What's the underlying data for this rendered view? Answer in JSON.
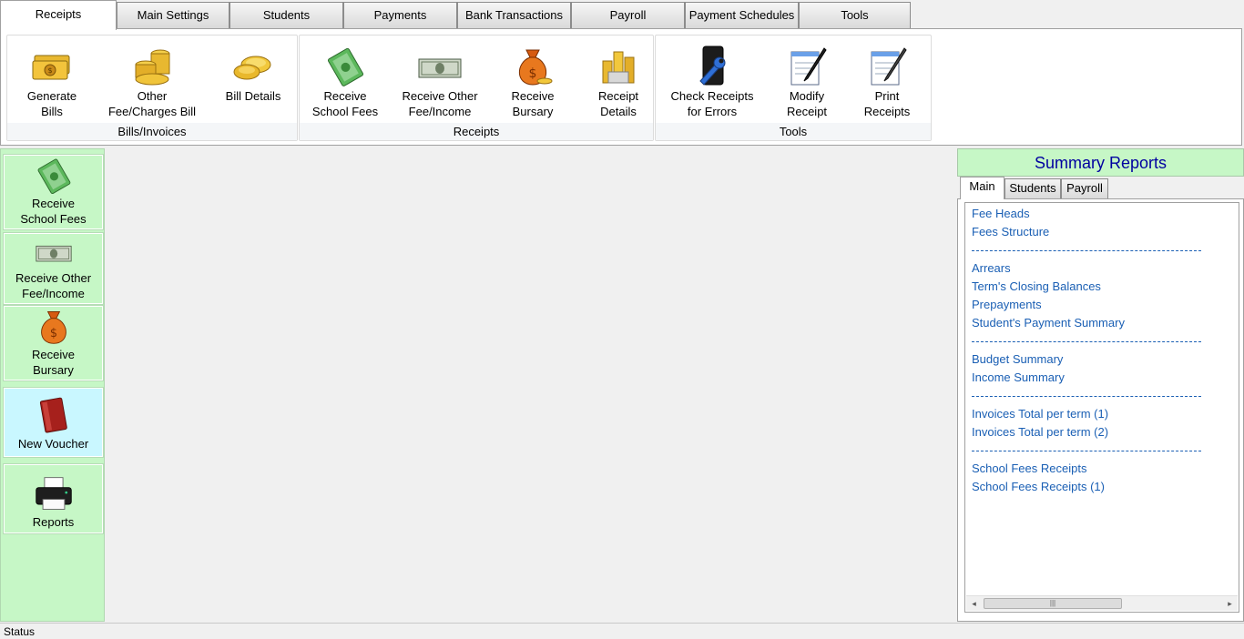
{
  "tabs": [
    {
      "label": "Receipts",
      "active": true
    },
    {
      "label": "Main Settings"
    },
    {
      "label": "Students"
    },
    {
      "label": "Payments"
    },
    {
      "label": "Bank Transactions"
    },
    {
      "label": "Payroll"
    },
    {
      "label": "Payment Schedules"
    },
    {
      "label": "Tools"
    }
  ],
  "ribbon": {
    "groups": [
      {
        "caption": "Bills/Invoices",
        "buttons": [
          {
            "label": "Generate\nBills",
            "icon": "money-bills-icon"
          },
          {
            "label": "Other\nFee/Charges Bill",
            "icon": "coin-stacks-icon"
          },
          {
            "label": "Bill Details",
            "icon": "gold-coins-icon"
          }
        ]
      },
      {
        "caption": "Receipts",
        "buttons": [
          {
            "label": "Receive\nSchool Fees",
            "icon": "cash-stack-icon"
          },
          {
            "label": "Receive Other\nFee/Income",
            "icon": "dollar-bill-icon"
          },
          {
            "label": "Receive\nBursary",
            "icon": "money-bag-icon"
          },
          {
            "label": "Receipt\nDetails",
            "icon": "coin-columns-icon"
          }
        ]
      },
      {
        "caption": "Tools",
        "buttons": [
          {
            "label": "Check Receipts\nfor Errors",
            "icon": "wrench-phone-icon"
          },
          {
            "label": "Modify\nReceipt",
            "icon": "notepad-pen-icon"
          },
          {
            "label": "Print\nReceipts",
            "icon": "notepad-pencil-icon"
          }
        ]
      }
    ]
  },
  "sidebar": {
    "items": [
      {
        "label": "Receive\nSchool Fees",
        "icon": "cash-stack-icon"
      },
      {
        "label": "Receive Other\nFee/Income",
        "icon": "dollar-bill-icon"
      },
      {
        "label": "Receive\nBursary",
        "icon": "money-bag-icon"
      },
      {
        "label": "New Voucher",
        "icon": "red-book-icon"
      },
      {
        "label": "Reports",
        "icon": "printer-icon"
      }
    ]
  },
  "summary": {
    "title": "Summary Reports",
    "tabs": [
      {
        "label": "Main",
        "active": true
      },
      {
        "label": "Students"
      },
      {
        "label": "Payroll"
      }
    ],
    "links": {
      "fee_heads": "Fee Heads",
      "fees_structure": "Fees Structure",
      "arrears": "Arrears",
      "terms_closing_balances": "Term's Closing Balances",
      "prepayments": "Prepayments",
      "students_payment_summary": "Student's Payment Summary",
      "budget_summary": "Budget Summary",
      "income_summary": "Income Summary",
      "invoices_total_1": "Invoices Total per term (1)",
      "invoices_total_2": "Invoices Total per term (2)",
      "school_fees_receipts": "School Fees Receipts",
      "school_fees_receipts_1": "School Fees Receipts (1)"
    }
  },
  "status": {
    "text": "Status"
  },
  "colors": {
    "sidebar_green": "#c6f7c6",
    "voucher_cyan": "#c9f7ff",
    "link_blue": "#1a5fb4",
    "summary_title_blue": "#0000a0"
  }
}
